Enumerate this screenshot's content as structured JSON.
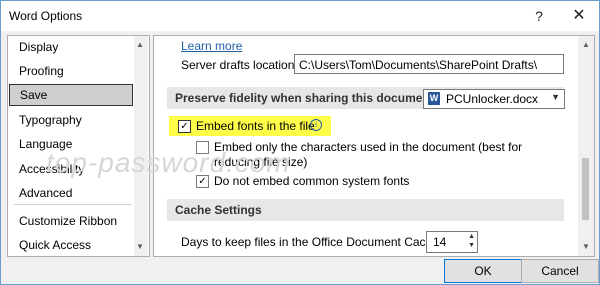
{
  "window": {
    "title": "Word Options",
    "help": "?",
    "close": "✕"
  },
  "nav": {
    "items": [
      {
        "label": "Display"
      },
      {
        "label": "Proofing"
      },
      {
        "label": "Save"
      },
      {
        "label": "Typography"
      },
      {
        "label": "Language"
      },
      {
        "label": "Accessibility"
      },
      {
        "label": "Advanced"
      },
      {
        "label": "Customize Ribbon"
      },
      {
        "label": "Quick Access Toolbar"
      }
    ],
    "selected": "Save"
  },
  "main": {
    "learn_more": "Learn more",
    "server_drafts_label": "Server drafts location:",
    "server_drafts_value": "C:\\Users\\Tom\\Documents\\SharePoint Drafts\\",
    "preserve_section": "Preserve fidelity when sharing this document:",
    "document_select": "PCUnlocker.docx",
    "embed_fonts": "Embed fonts in the file",
    "embed_only_chars": "Embed only the characters used in the document (best for reducing file size)",
    "do_not_embed_common": "Do not embed common system fonts",
    "cache_section": "Cache Settings",
    "days_label": "Days to keep files in the Office Document Cache:",
    "days_value": "14",
    "watermark": "top-password.com"
  },
  "buttons": {
    "ok": "OK",
    "cancel": "Cancel"
  },
  "colors": {
    "highlight": "#ffff4a",
    "link": "#1f5fa8"
  }
}
